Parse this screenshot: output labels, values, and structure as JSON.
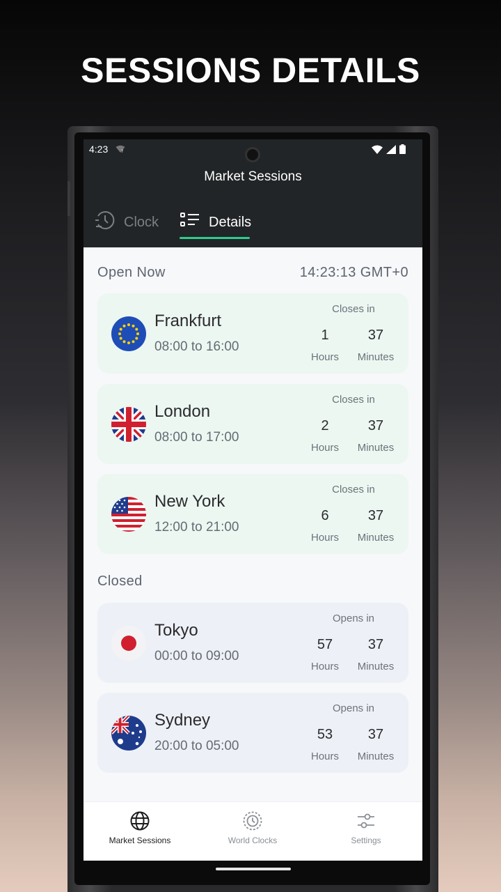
{
  "promo": {
    "title": "SESSIONS DETAILS"
  },
  "status_bar": {
    "time": "4:23"
  },
  "app": {
    "title": "Market Sessions",
    "tabs": [
      {
        "label": "Clock",
        "icon": "clock-icon",
        "active": false
      },
      {
        "label": "Details",
        "icon": "list-icon",
        "active": true
      }
    ]
  },
  "open_section": {
    "label": "Open Now",
    "current_time": "14:23:13  GMT+0"
  },
  "closed_section": {
    "label": "Closed"
  },
  "sessions_open": [
    {
      "city": "Frankfurt",
      "hours": "08:00 to 16:00",
      "countdown_label": "Closes in",
      "h": "1",
      "m": "37",
      "h_unit": "Hours",
      "m_unit": "Minutes",
      "flag": "eu-flag-icon"
    },
    {
      "city": "London",
      "hours": "08:00 to 17:00",
      "countdown_label": "Closes in",
      "h": "2",
      "m": "37",
      "h_unit": "Hours",
      "m_unit": "Minutes",
      "flag": "uk-flag-icon"
    },
    {
      "city": "New York",
      "hours": "12:00 to 21:00",
      "countdown_label": "Closes in",
      "h": "6",
      "m": "37",
      "h_unit": "Hours",
      "m_unit": "Minutes",
      "flag": "us-flag-icon"
    }
  ],
  "sessions_closed": [
    {
      "city": "Tokyo",
      "hours": "00:00 to 09:00",
      "countdown_label": "Opens in",
      "h": "57",
      "m": "37",
      "h_unit": "Hours",
      "m_unit": "Minutes",
      "flag": "japan-flag-icon"
    },
    {
      "city": "Sydney",
      "hours": "20:00 to 05:00",
      "countdown_label": "Opens in",
      "h": "53",
      "m": "37",
      "h_unit": "Hours",
      "m_unit": "Minutes",
      "flag": "australia-flag-icon"
    }
  ],
  "bottom_nav": [
    {
      "label": "Market Sessions",
      "icon": "globe-icon",
      "active": true
    },
    {
      "label": "World Clocks",
      "icon": "world-clock-icon",
      "active": false
    },
    {
      "label": "Settings",
      "icon": "sliders-icon",
      "active": false
    }
  ],
  "colors": {
    "accent": "#2ecc8f",
    "appbar": "#222527",
    "open_card": "#ecf7f1",
    "closed_card": "#edf0f6"
  }
}
